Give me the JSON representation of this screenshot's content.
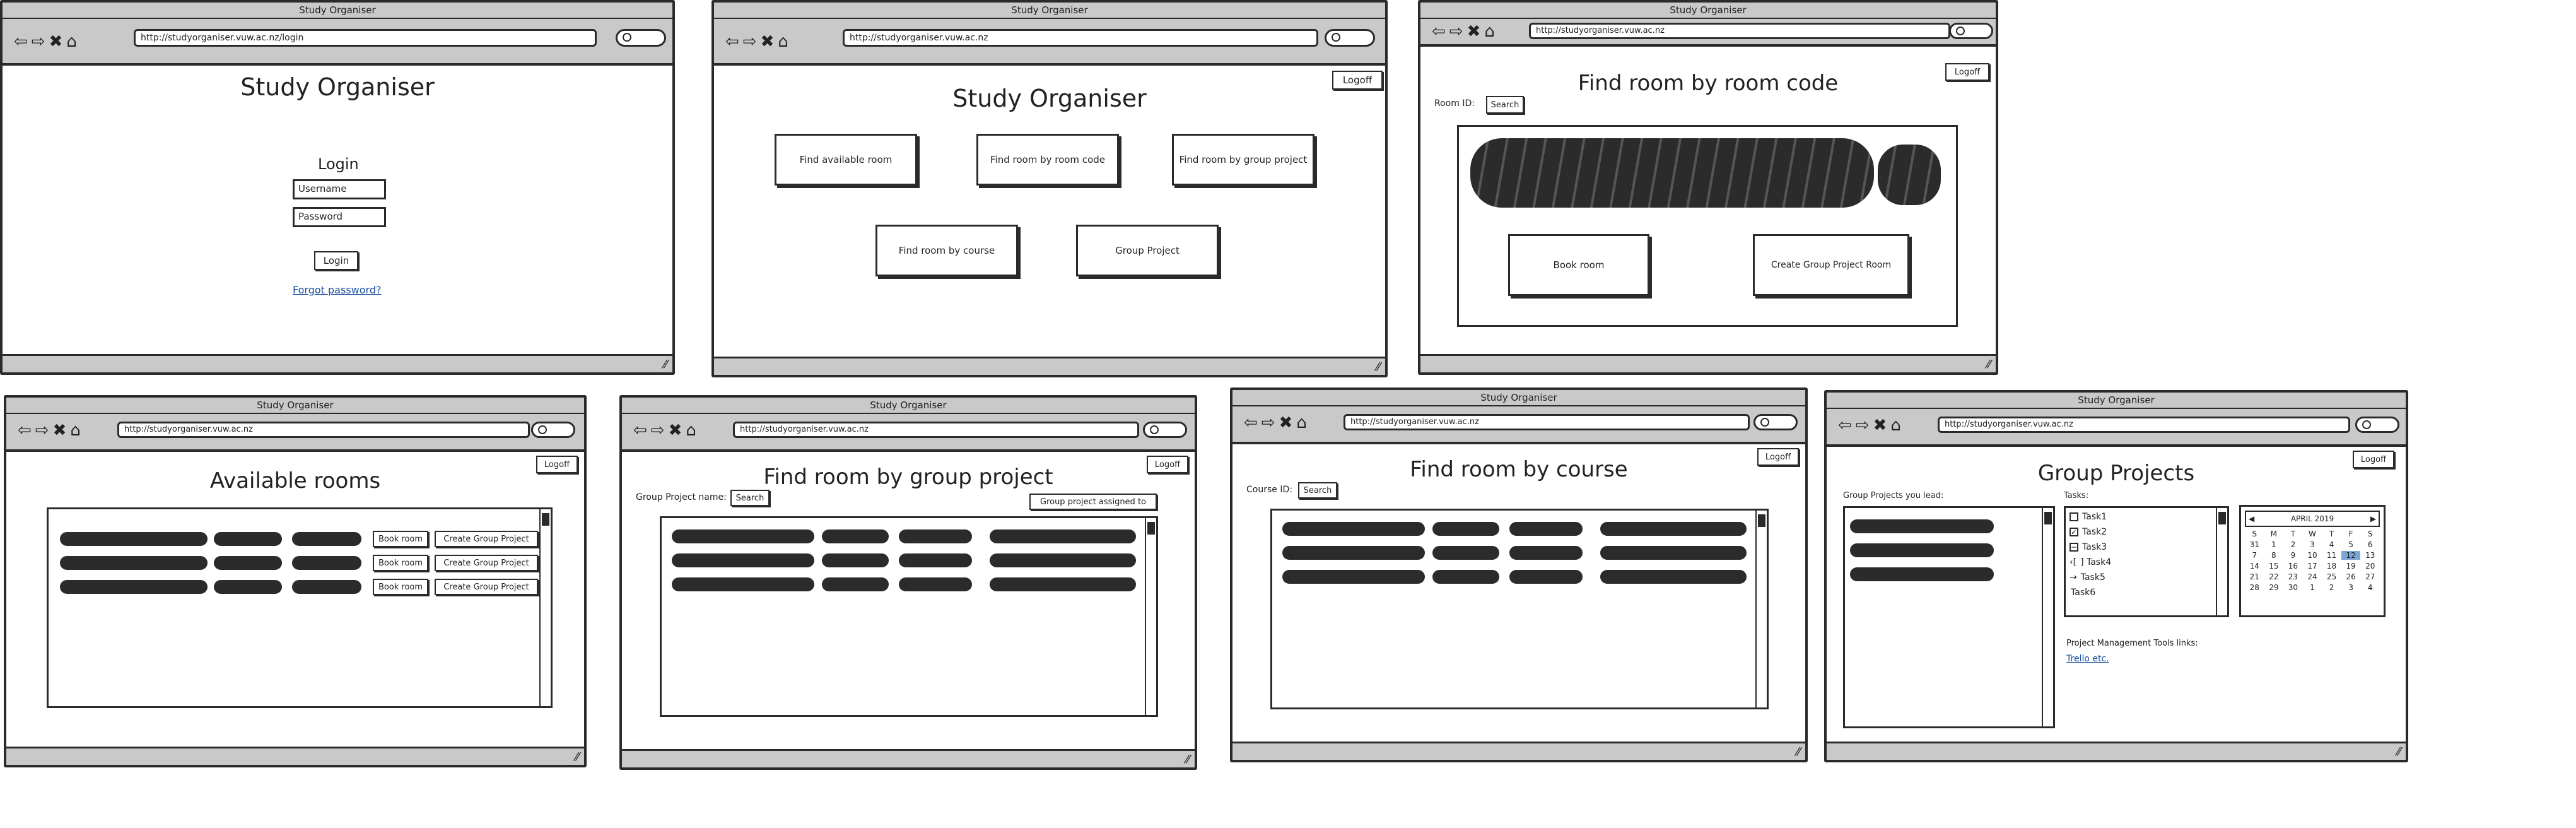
{
  "app_title": "Study Organiser",
  "screens": {
    "login": {
      "url": "http://studyorganiser.vuw.ac.nz/login",
      "heading": "Study Organiser",
      "login_label": "Login",
      "username_placeholder": "Username",
      "password_placeholder": "Password",
      "login_button": "Login",
      "forgot_link": "Forgot password?"
    },
    "home": {
      "url": "http://studyorganiser.vuw.ac.nz",
      "heading": "Study Organiser",
      "logoff": "Logoff",
      "buttons": [
        "Find available room",
        "Find room by room code",
        "Find room by group project",
        "Find room by course",
        "Group Project"
      ]
    },
    "room_code": {
      "url": "http://studyorganiser.vuw.ac.nz",
      "heading": "Find room by room code",
      "logoff": "Logoff",
      "room_id_label": "Room ID:",
      "search_button": "Search",
      "book_button": "Book room",
      "create_button": "Create Group Project Room"
    },
    "available": {
      "url": "http://studyorganiser.vuw.ac.nz",
      "heading": "Available rooms",
      "logoff": "Logoff",
      "book_button": "Book room",
      "create_button": "Create Group Project"
    },
    "group_project_find": {
      "url": "http://studyorganiser.vuw.ac.nz",
      "heading": "Find room by group project",
      "logoff": "Logoff",
      "name_label": "Group Project name:",
      "search_button": "Search",
      "assigned_button": "Group project assigned to"
    },
    "course": {
      "url": "http://studyorganiser.vuw.ac.nz",
      "heading": "Find room by course",
      "logoff": "Logoff",
      "course_label": "Course ID:",
      "search_button": "Search"
    },
    "group_projects": {
      "url": "http://studyorganiser.vuw.ac.nz",
      "heading": "Group Projects",
      "logoff": "Logoff",
      "lead_label": "Group Projects you lead:",
      "tasks_label": "Tasks:",
      "tasks": [
        {
          "label": "Task1",
          "state": "unchecked"
        },
        {
          "label": "Task2",
          "state": "checked"
        },
        {
          "label": "Task3",
          "state": "minus"
        },
        {
          "label": "] Task4",
          "state": "bracket"
        },
        {
          "label": "Task5",
          "state": "arrow"
        },
        {
          "label": "Task6",
          "state": "none"
        }
      ],
      "calendar": {
        "month": "APRIL 2019",
        "weekdays": [
          "S",
          "M",
          "T",
          "W",
          "T",
          "F",
          "S"
        ],
        "days": [
          "31",
          "1",
          "2",
          "3",
          "4",
          "5",
          "6",
          "7",
          "8",
          "9",
          "10",
          "11",
          "12",
          "13",
          "14",
          "15",
          "16",
          "17",
          "18",
          "19",
          "20",
          "21",
          "22",
          "23",
          "24",
          "25",
          "26",
          "27",
          "28",
          "29",
          "30",
          "1",
          "2",
          "3",
          "4"
        ],
        "today": "12"
      },
      "links_label": "Project Management Tools links:",
      "link": "Trello etc."
    }
  },
  "icons": {
    "back": "arrow-left-icon",
    "forward": "arrow-right-icon",
    "stop": "close-icon",
    "home": "home-icon",
    "search": "search-icon",
    "resize": "resize-grip-icon"
  }
}
